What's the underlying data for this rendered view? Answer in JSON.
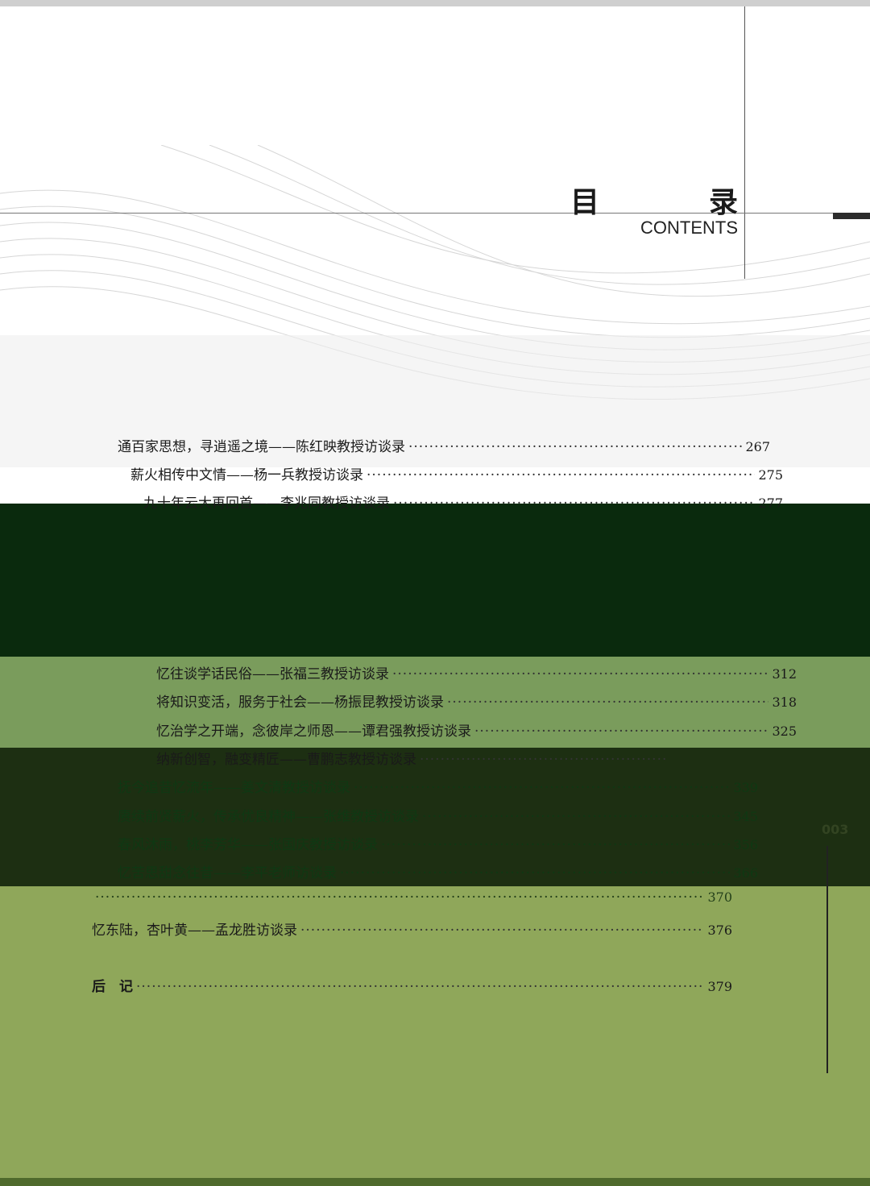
{
  "header": {
    "title": "目　录",
    "subtitle": "CONTENTS"
  },
  "side_page_number": "003",
  "toc": [
    {
      "title": "通百家思想，寻逍遥之境——陈红映教授访谈录",
      "page": "267"
    },
    {
      "title": "薪火相传中文情——杨一兵教授访谈录",
      "page": "275"
    },
    {
      "title": "九十年云大再回首——李兆同教授访谈录",
      "page": "277"
    },
    {
      "title": "忆往谈学话民俗——张福三教授访谈录",
      "page": "312"
    },
    {
      "title": "将知识变活，服务于社会——杨振昆教授访谈录",
      "page": "318"
    },
    {
      "title": "忆治学之开端，念彼岸之师恩——谭君强教授访谈录",
      "page": "325"
    },
    {
      "title": "纳新创智，融变精匠——曹鹏志教授访谈录",
      "page": ""
    },
    {
      "title": "抚今追昔忆流年——姜文清教授访谈录",
      "page": "339"
    },
    {
      "title": "赓续前贤薪火，传承优良精神——张维教授访谈录",
      "page": "345"
    },
    {
      "title": "春风沐雨，桃李芳华——张国庆教授访谈录",
      "page": "356"
    },
    {
      "title": "忆苦思甜念往昔——李平老师访谈录",
      "page": "366"
    },
    {
      "title": "",
      "page": "370"
    },
    {
      "title": "忆东陆，杏叶黄——孟龙胜访谈录",
      "page": "376"
    },
    {
      "title": "后　记",
      "page": "379"
    }
  ]
}
